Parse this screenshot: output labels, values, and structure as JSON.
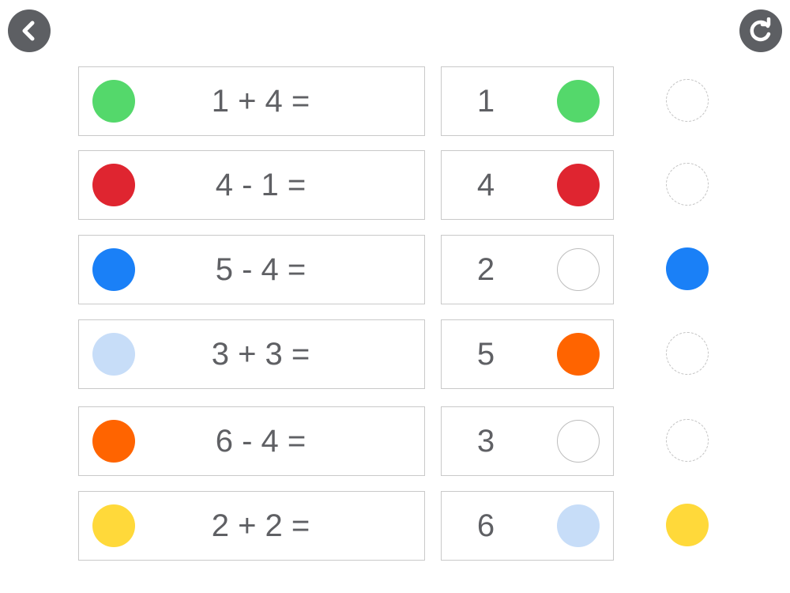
{
  "nav": {
    "back_icon": "chevron-left-icon",
    "reset_icon": "refresh-icon",
    "button_color": "#5d5f63"
  },
  "colors": {
    "green": "#54d86b",
    "red": "#df2530",
    "blue": "#1a80f7",
    "light_blue": "#c7ddf8",
    "orange": "#ff6400",
    "yellow": "#ffd93a"
  },
  "rows": [
    {
      "equation": "1 + 4 =",
      "eq_color": "#54d86b",
      "answer": "1",
      "ans_color": "#54d86b",
      "slot_color": null
    },
    {
      "equation": "4 - 1 =",
      "eq_color": "#df2530",
      "answer": "4",
      "ans_color": "#df2530",
      "slot_color": null
    },
    {
      "equation": "5 - 4 =",
      "eq_color": "#1a80f7",
      "answer": "2",
      "ans_color": null,
      "slot_color": "#1a80f7"
    },
    {
      "equation": "3 + 3 =",
      "eq_color": "#c7ddf8",
      "answer": "5",
      "ans_color": "#ff6400",
      "slot_color": null
    },
    {
      "equation": "6 - 4 =",
      "eq_color": "#ff6400",
      "answer": "3",
      "ans_color": null,
      "slot_color": null
    },
    {
      "equation": "2 + 2 =",
      "eq_color": "#ffd93a",
      "answer": "6",
      "ans_color": "#c7ddf8",
      "slot_color": "#ffd93a"
    }
  ]
}
